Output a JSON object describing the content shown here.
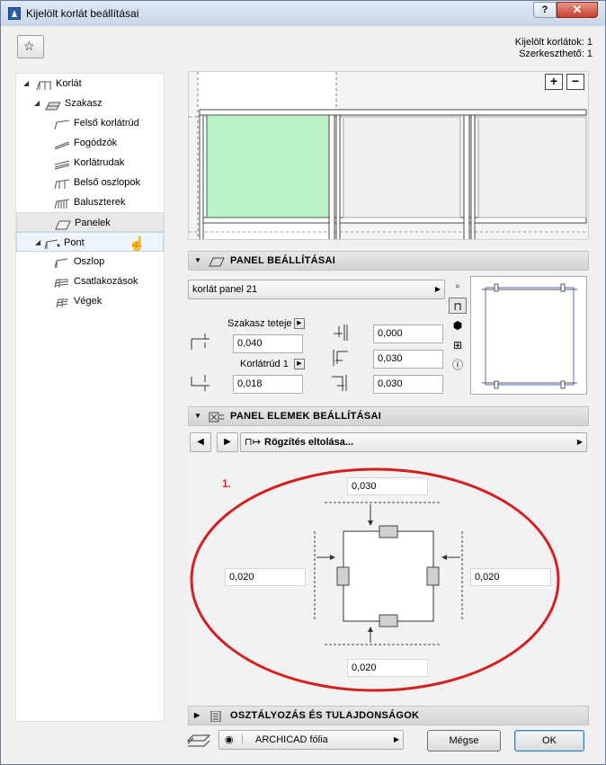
{
  "window": {
    "title": "Kijelölt korlát beállításai",
    "help_label": "?",
    "close_label": "✕"
  },
  "selection_info": {
    "selected": "Kijelölt korlátok: 1",
    "editable": "Szerkeszthető: 1"
  },
  "tree": {
    "items": [
      {
        "label": "Korlát",
        "icon": "railing-icon"
      },
      {
        "label": "Szakasz",
        "icon": "segment-icon"
      },
      {
        "label": "Felső korlátrúd",
        "icon": "top-rail-icon"
      },
      {
        "label": "Fogódzók",
        "icon": "handrail-icon"
      },
      {
        "label": "Korlátrudak",
        "icon": "rails-icon"
      },
      {
        "label": "Belső oszlopok",
        "icon": "inner-posts-icon"
      },
      {
        "label": "Baluszterek",
        "icon": "balusters-icon"
      },
      {
        "label": "Panelek",
        "icon": "panels-icon"
      },
      {
        "label": "Pont",
        "icon": "node-icon"
      },
      {
        "label": "Oszlop",
        "icon": "post-icon"
      },
      {
        "label": "Csatlakozások",
        "icon": "connections-icon"
      },
      {
        "label": "Végek",
        "icon": "ends-icon"
      }
    ]
  },
  "preview": {
    "zoom_in": "+",
    "zoom_out": "−"
  },
  "panel_settings": {
    "header": "PANEL BEÁLLÍTÁSAI",
    "panel_type": "korlát panel 21",
    "top_ref_label": "Szakasz teteje",
    "top_offset": "0,040",
    "bottom_ref_label": "Korlátrúd 1",
    "bottom_offset": "0,018",
    "inset": "0,000",
    "gap_top": "0,030",
    "gap_bottom": "0,030"
  },
  "panel_element_settings": {
    "header": "PANEL ELEMEK BEÁLLÍTÁSAI",
    "mode": "Rögzítés eltolása...",
    "annotation": "1.",
    "top_offset": "0,030",
    "left_offset": "0,020",
    "right_offset": "0,020",
    "bottom_offset": "0,020"
  },
  "classification": {
    "header": "OSZTÁLYOZÁS ÉS TULAJDONSÁGOK"
  },
  "footer": {
    "layer": "ARCHICAD fólia",
    "cancel": "Mégse",
    "ok": "OK"
  },
  "colors": {
    "panel_fill": "#b9f2c6",
    "highlight_ellipse": "#d42020"
  }
}
